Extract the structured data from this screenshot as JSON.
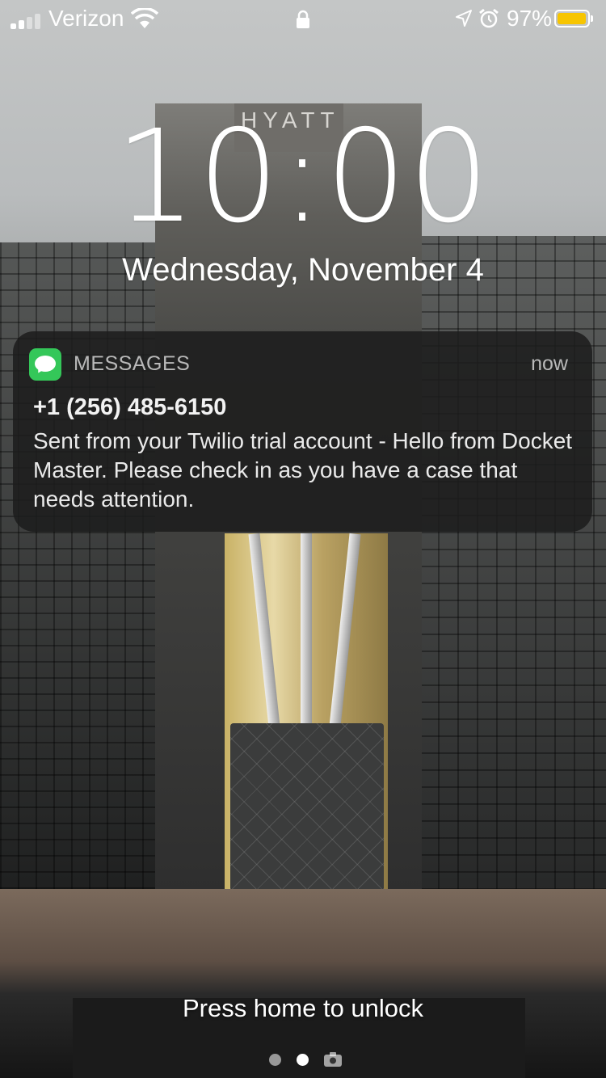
{
  "status_bar": {
    "carrier": "Verizon",
    "battery_percent": "97%",
    "battery_level": 0.97,
    "battery_color": "#f7c500",
    "icons": [
      "signal-bars-icon",
      "wifi-icon",
      "lock-icon",
      "location-arrow-icon",
      "alarm-icon",
      "battery-icon"
    ]
  },
  "lock_screen": {
    "time": "10:00",
    "date": "Wednesday, November 4",
    "unlock_hint": "Press home to unlock",
    "page_dots": {
      "count": 2,
      "active_index": 1
    }
  },
  "notification": {
    "app_name": "MESSAGES",
    "app_icon": "messages-app-icon",
    "app_color": "#34c759",
    "timestamp": "now",
    "sender": "+1 (256) 485-6150",
    "body": "Sent from your Twilio trial account - Hello from Docket Master.  Please check in as you have a case that needs attention."
  },
  "wallpaper": {
    "sign_text": "HYATT"
  }
}
